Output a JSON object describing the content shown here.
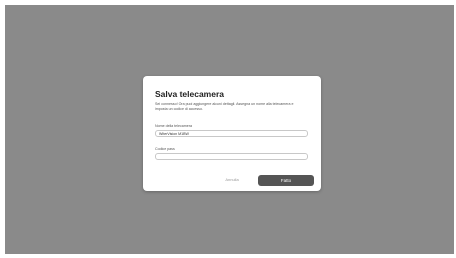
{
  "dialog": {
    "title": "Salva telecamera",
    "description": "Sei connesso! Ora puoi aggiungere alcuni dettagli. Assegna un nome alla telecamera e imposta un codice di accesso.",
    "camera_name": {
      "label": "Nome della telecamera",
      "value": "WiterVision M1BW"
    },
    "passcode": {
      "label": "Codice pass",
      "value": ""
    },
    "cancel_label": "Annulla",
    "done_label": "Fatto"
  },
  "colors": {
    "overlay": "#8a8a8a",
    "primary_button": "#555555",
    "cancel_text": "#9a9a9a"
  }
}
